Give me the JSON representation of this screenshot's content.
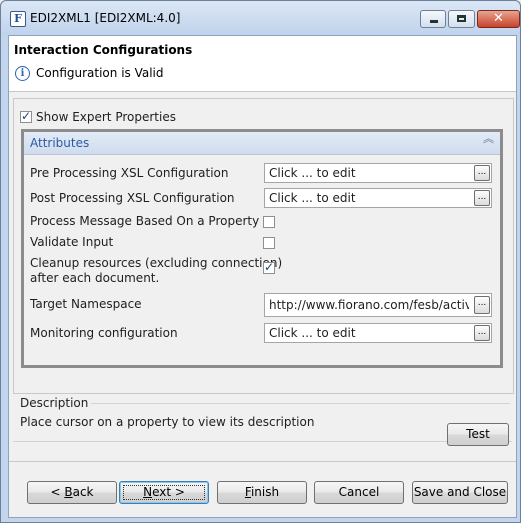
{
  "window": {
    "title": "EDI2XML1 [EDI2XML:4.0]",
    "app_icon_letter": "F",
    "buttons": {
      "minimize": "",
      "maximize": "",
      "close": "✕"
    }
  },
  "header": {
    "title": "Interaction Configurations",
    "status": "Configuration is Valid",
    "status_icon": "info-icon"
  },
  "options": {
    "show_expert_label": "Show Expert Properties",
    "show_expert_checked": true
  },
  "attributes": {
    "title": "Attributes",
    "collapse_icon": "double-chevron-up-icon",
    "properties": [
      {
        "label": "Pre Processing XSL Configuration",
        "type": "editor",
        "value": "Click ... to edit",
        "button": "..."
      },
      {
        "label": "Post Processing XSL Configuration",
        "type": "editor",
        "value": "Click ... to edit",
        "button": "..."
      },
      {
        "label": "Process Message Based On a Property",
        "type": "checkbox",
        "checked": false
      },
      {
        "label": "Validate Input",
        "type": "checkbox",
        "checked": false
      },
      {
        "label_line1": "Cleanup resources (excluding connection)",
        "label_line2": "after each document.",
        "type": "checkbox",
        "checked": true
      },
      {
        "label": "Target Namespace",
        "type": "editor",
        "value": "http://www.fiorano.com/fesb/activity",
        "button": "..."
      },
      {
        "label": "Monitoring configuration",
        "type": "editor",
        "value": "Click ... to edit",
        "button": "..."
      }
    ]
  },
  "description": {
    "title": "Description",
    "text": "Place cursor on a property to view its description"
  },
  "buttons": {
    "test": "Test",
    "back_mnemonic": "B",
    "back_pre": "< ",
    "back_rest": "ack",
    "next_mnemonic": "N",
    "next_rest": "ext >",
    "finish_mnemonic": "F",
    "finish_rest": "inish",
    "cancel": "Cancel",
    "save_close": "Save and Close"
  }
}
